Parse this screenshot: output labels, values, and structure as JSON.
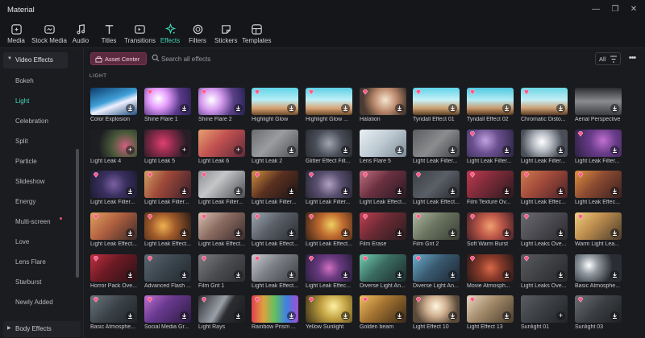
{
  "window": {
    "title": "Material",
    "controls": {
      "minimize": "—",
      "restore": "❐",
      "close": "✕"
    }
  },
  "toolbar": {
    "active": "Effects",
    "active_color": "#43d6b8",
    "items": [
      {
        "label": "Media",
        "icon": "media-icon"
      },
      {
        "label": "Stock Media",
        "icon": "stock-media-icon"
      },
      {
        "label": "Audio",
        "icon": "audio-note-icon"
      },
      {
        "label": "Titles",
        "icon": "titles-t-icon"
      },
      {
        "label": "Transitions",
        "icon": "transitions-icon"
      },
      {
        "label": "Effects",
        "icon": "effects-sparkle-icon"
      },
      {
        "label": "Filters",
        "icon": "filters-icon"
      },
      {
        "label": "Stickers",
        "icon": "stickers-icon"
      },
      {
        "label": "Templates",
        "icon": "templates-icon"
      }
    ]
  },
  "sidebar": {
    "header": "Video Effects",
    "items": [
      {
        "label": "Bokeh"
      },
      {
        "label": "Light",
        "active": true
      },
      {
        "label": "Celebration"
      },
      {
        "label": "Split"
      },
      {
        "label": "Particle"
      },
      {
        "label": "Slideshow"
      },
      {
        "label": "Energy"
      },
      {
        "label": "Multi-screen",
        "badge": true
      },
      {
        "label": "Love"
      },
      {
        "label": "Lens Flare"
      },
      {
        "label": "Starburst"
      },
      {
        "label": "Newly Added"
      }
    ],
    "footer": "Body Effects"
  },
  "search": {
    "asset_center_label": "Asset Center",
    "placeholder": "Search all effects",
    "filter_label": "All",
    "more_label": "•••"
  },
  "section": {
    "label": "LIGHT"
  },
  "effects": [
    {
      "name": "Color Explosion",
      "bg": "linear-gradient(160deg,#0c3a6a,#3fa0d8 45%,#f0f0ff 60%,#1b4b7a)",
      "gem": false,
      "action": "download"
    },
    {
      "name": "Shine Flare 1",
      "bg": "radial-gradient(circle at 30% 40%,#ffffff,#e8a0ff 25%,#5a3a8a 60%,#2a2050)",
      "gem": true,
      "action": "download"
    },
    {
      "name": "Shine Flare 2",
      "bg": "radial-gradient(circle at 28% 45%,#ffffff,#d79cf0 28%,#5b4188 60%,#232050)",
      "gem": true,
      "action": "download"
    },
    {
      "name": "Highlight Glow",
      "bg": "linear-gradient(180deg,#5fd4e8,#b8eef6 45%,#d6a070 75%,#6a4a2a)",
      "gem": true,
      "action": "download"
    },
    {
      "name": "Highlight Glow ...",
      "bg": "linear-gradient(180deg,#5ccfe4,#c2f0f7 45%,#d9a476 75%,#6a4a2a)",
      "gem": true,
      "action": "download"
    },
    {
      "name": "Halation",
      "bg": "radial-gradient(circle at 55% 45%,#f6e4cf,#b9876a 40%,#4a3a32 75%)",
      "gem": true,
      "action": "download"
    },
    {
      "name": "Tyndall Effect 01",
      "bg": "linear-gradient(180deg,#5fd4e8,#c8f2f8 45%,#caa070 75%,#5a3e24)",
      "gem": true,
      "action": "download"
    },
    {
      "name": "Tyndall Effect 02",
      "bg": "linear-gradient(180deg,#4fc8e0,#b4ecf6 45%,#c89a6c 75%,#55381f)",
      "gem": true,
      "action": "download"
    },
    {
      "name": "Chromatic Disto...",
      "bg": "linear-gradient(180deg,#6ad6e6,#c6eef4 45%,#c89e72 75%,#5a3a24)",
      "gem": true,
      "action": "download"
    },
    {
      "name": "Aerial Perspective",
      "bg": "linear-gradient(180deg,#2a2c30,#8a8c90 50%,#3a3c40)",
      "gem": false,
      "action": "download"
    },
    {
      "name": "Light Leak 4",
      "bg": "radial-gradient(circle at 75% 60%,#d06080,#4a5a3a 35%,#1c1e22 70%)",
      "gem": false,
      "action": "add"
    },
    {
      "name": "Light Leak 5",
      "bg": "radial-gradient(circle at 40% 50%,#e04070,#8a2a4a 35%,#2a1e26 75%)",
      "gem": false,
      "action": "add"
    },
    {
      "name": "Light Leak 6",
      "bg": "linear-gradient(135deg,#e8a070,#c05050 45%,#602a3a)",
      "gem": false,
      "action": "add"
    },
    {
      "name": "Light Leak 2",
      "bg": "linear-gradient(135deg,#6a6c70,#9a9ca0 45%,#4a4c50)",
      "gem": false,
      "action": "download"
    },
    {
      "name": "Glitter Effect Filt...",
      "bg": "radial-gradient(circle at 50% 50%,#a0a4b0,#4a4e58 50%,#2a2c32)",
      "gem": false,
      "action": "download"
    },
    {
      "name": "Lens Flare 5",
      "bg": "linear-gradient(135deg,#e8f0f4,#bcc8d0 50%,#7a8a96)",
      "gem": false,
      "action": "download"
    },
    {
      "name": "Light Leak Filter...",
      "bg": "linear-gradient(135deg,#5a5c60,#8a8c8e 50%,#3c3e42)",
      "gem": false,
      "action": "download"
    },
    {
      "name": "Light Leak Filter...",
      "bg": "radial-gradient(circle at 40% 40%,#c0a0e0,#6a5090 40%,#2a2440)",
      "gem": true,
      "action": "download"
    },
    {
      "name": "Light Leak Filter...",
      "bg": "radial-gradient(circle at 45% 45%,#ffffff,#b8bcc4 30%,#4a4e56 70%)",
      "gem": false,
      "action": "download"
    },
    {
      "name": "Light Leak Filter...",
      "bg": "radial-gradient(circle at 60% 40%,#c070d0,#6a3c8a 40%,#2a2040)",
      "gem": true,
      "action": "download"
    },
    {
      "name": "Light Leak Filter...",
      "bg": "radial-gradient(circle at 50% 50%,#7a60a0,#3a3060 45%,#1c1a30)",
      "gem": true,
      "action": "download"
    },
    {
      "name": "Light Leak Filter...",
      "bg": "linear-gradient(120deg,#d0a060,#a04a3a 40%,#3a1e2a)",
      "gem": true,
      "action": "download"
    },
    {
      "name": "Light Leak Filter...",
      "bg": "linear-gradient(135deg,#8a8c90,#c4c6c8 40%,#4a4c50)",
      "gem": true,
      "action": "download"
    },
    {
      "name": "Light Leak Filter...",
      "bg": "linear-gradient(135deg,#d09040,#5a3020 45%,#1a1416)",
      "gem": true,
      "action": "download"
    },
    {
      "name": "Light Leak Filter...",
      "bg": "radial-gradient(circle at 50% 50%,#b0a0c0,#5a5070 45%,#2a2836)",
      "gem": true,
      "action": "download"
    },
    {
      "name": "Light Leak Effect...",
      "bg": "linear-gradient(135deg,#c07080,#6a3040 45%,#2a1a22)",
      "gem": true,
      "action": "download"
    },
    {
      "name": "Light Leak Effect...",
      "bg": "linear-gradient(135deg,#3a3e44,#5a5e66 50%,#26282c)",
      "gem": true,
      "action": "download"
    },
    {
      "name": "Film Texture Ov...",
      "bg": "linear-gradient(135deg,#c03a50,#7a2a38 45%,#2a1a1e)",
      "gem": true,
      "action": "download"
    },
    {
      "name": "Light Leak Effec...",
      "bg": "linear-gradient(135deg,#d07a50,#a04a3a 45%,#4a2228)",
      "gem": true,
      "action": "download"
    },
    {
      "name": "Light Leak Effec...",
      "bg": "linear-gradient(135deg,#e09040,#8a4a30 45%,#3a2020)",
      "gem": true,
      "action": "download"
    },
    {
      "name": "Light Leak Effect...",
      "bg": "linear-gradient(135deg,#e0a060,#b06040 45%,#3a2a28)",
      "gem": true,
      "action": "download"
    },
    {
      "name": "Light Leak Effect...",
      "bg": "radial-gradient(circle at 40% 50%,#f0b050,#a05a2a 40%,#2a1c18)",
      "gem": true,
      "action": "download"
    },
    {
      "name": "Light Leak Effect...",
      "bg": "linear-gradient(135deg,#d8c0b0,#8a6a60 45%,#3a2c2c)",
      "gem": true,
      "action": "download"
    },
    {
      "name": "Light Leak Effect...",
      "bg": "linear-gradient(135deg,#a0a6b0,#5a6068 45%,#2a2c30)",
      "gem": true,
      "action": "download"
    },
    {
      "name": "Light Leak Effect...",
      "bg": "radial-gradient(circle at 55% 45%,#f0d060,#c06a30 40%,#3a2418)",
      "gem": true,
      "action": "download"
    },
    {
      "name": "Film Erase",
      "bg": "linear-gradient(135deg,#c04050,#6a2a34 45%,#2a1c1e)",
      "gem": true,
      "action": "download"
    },
    {
      "name": "Film Grit 2",
      "bg": "linear-gradient(135deg,#b0b8a0,#6a7460 45%,#3a3e34)",
      "gem": true,
      "action": "download"
    },
    {
      "name": "Soft Warm Burst",
      "bg": "radial-gradient(circle at 50% 50%,#f0a070,#c05a4a 40%,#4a2228)",
      "gem": true,
      "action": "download"
    },
    {
      "name": "Light Leaks Ove...",
      "bg": "linear-gradient(135deg,#6a6a70,#4a4a50 50%,#2a2a2e)",
      "gem": true,
      "action": "download"
    },
    {
      "name": "Warm Light Lea...",
      "bg": "linear-gradient(135deg,#f0d080,#c09050 40%,#4a3a2a)",
      "gem": true,
      "action": "download"
    },
    {
      "name": "Horror Pack Ove...",
      "bg": "linear-gradient(135deg,#c03040,#6a1a24 45%,#2a1216)",
      "gem": true,
      "action": "download"
    },
    {
      "name": "Advanced Flash ...",
      "bg": "linear-gradient(135deg,#5a6670,#3a444c 50%,#22282c)",
      "gem": true,
      "action": "download"
    },
    {
      "name": "Film Grit 1",
      "bg": "linear-gradient(135deg,#7a7c80,#4a4c50 50%,#2a2c2e)",
      "gem": true,
      "action": "download"
    },
    {
      "name": "Light Leak Effect...",
      "bg": "linear-gradient(135deg,#c8ccd0,#7a7e84 45%,#3a3c40)",
      "gem": true,
      "action": "download"
    },
    {
      "name": "Light Leak Effec...",
      "bg": "radial-gradient(circle at 50% 50%,#d070c0,#6a3a80 40%,#2a2040)",
      "gem": true,
      "action": "download"
    },
    {
      "name": "Diverse Light An...",
      "bg": "linear-gradient(135deg,#70d0b0,#3a6a60 45%,#1c2a2a)",
      "gem": true,
      "action": "download"
    },
    {
      "name": "Diverse Light An...",
      "bg": "linear-gradient(135deg,#6ab0d0,#3a5a70 45%,#1c2430)",
      "gem": true,
      "action": "download"
    },
    {
      "name": "Movie Atmosph...",
      "bg": "radial-gradient(circle at 50% 50%,#d86a4a,#8a3a2a 40%,#2a1a18)",
      "gem": true,
      "action": "download"
    },
    {
      "name": "Light Leaks Ove...",
      "bg": "linear-gradient(135deg,#5a5c60,#3e4044 50%,#26282a)",
      "gem": true,
      "action": "download"
    },
    {
      "name": "Basic Atmosphe...",
      "bg": "radial-gradient(circle at 30% 40%,#ffffff,#9098a0 25%,#2a2e34 65%)",
      "gem": false,
      "action": "download"
    },
    {
      "name": "Basic Atmosphe...",
      "bg": "linear-gradient(135deg,#6a747c,#3a4248 50%,#1e2226)",
      "gem": true,
      "action": "download"
    },
    {
      "name": "Social Media Gr...",
      "bg": "linear-gradient(135deg,#c070d0,#6a3a90 40%,#2a1a40)",
      "gem": true,
      "action": "download"
    },
    {
      "name": "Light Rays",
      "bg": "linear-gradient(120deg,#2a2c30,#9aa0a8 45%,#2a2c30 60%,#1a1c1e)",
      "gem": true,
      "action": "download"
    },
    {
      "name": "Rainbow Prism ...",
      "bg": "linear-gradient(90deg,#e04050,#e0a040 25%,#60c060 50%,#4080e0 75%,#a050d0)",
      "gem": true,
      "action": "download"
    },
    {
      "name": "Yellow Sunlight",
      "bg": "radial-gradient(circle at 60% 40%,#fff0a0,#c0a040 40%,#3a3018)",
      "gem": true,
      "action": "download"
    },
    {
      "name": "Golden beam",
      "bg": "linear-gradient(135deg,#f0c060,#a07030 45%,#3a2a18)",
      "gem": true,
      "action": "download"
    },
    {
      "name": "Light Effect 10",
      "bg": "radial-gradient(circle at 50% 40%,#fff6e0,#d0b090 35%,#5a4a3a 75%)",
      "gem": true,
      "action": "download"
    },
    {
      "name": "Light Effect 13",
      "bg": "linear-gradient(135deg,#e8d8c0,#a08868 45%,#4a3c2c)",
      "gem": true,
      "action": "download"
    },
    {
      "name": "Sunlight 01",
      "bg": "linear-gradient(135deg,#5a5e62,#3a3e42 50%,#222426)",
      "gem": false,
      "action": "add"
    },
    {
      "name": "Sunlight 03",
      "bg": "linear-gradient(135deg,#6a6e72,#3a3e42 50%,#1e2022)",
      "gem": true,
      "action": "download"
    }
  ]
}
